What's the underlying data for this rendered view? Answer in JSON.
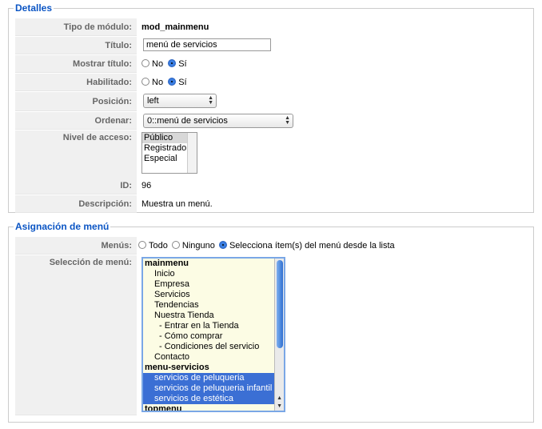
{
  "details": {
    "legend": "Detalles",
    "module_type_label": "Tipo de módulo:",
    "module_type_value": "mod_mainmenu",
    "title_label": "Título:",
    "title_value": "menú de servicios",
    "show_title_label": "Mostrar título:",
    "show_title_no": "No",
    "show_title_yes": "Sí",
    "enabled_label": "Habilitado:",
    "enabled_no": "No",
    "enabled_yes": "Sí",
    "position_label": "Posición:",
    "position_value": "left",
    "order_label": "Ordenar:",
    "order_value": "0::menú de servicios",
    "access_label": "Nivel de acceso:",
    "access_options": [
      "Público",
      "Registrado",
      "Especial"
    ],
    "id_label": "ID:",
    "id_value": "96",
    "description_label": "Descripción:",
    "description_value": "Muestra un menú."
  },
  "assignment": {
    "legend": "Asignación de menú",
    "menus_label": "Menús:",
    "opt_all": "Todo",
    "opt_none": "Ninguno",
    "opt_select": "Selecciona ítem(s) del menú desde la lista",
    "selection_label": "Selección de menú:",
    "items": [
      "mainmenu",
      "Inicio",
      "Empresa",
      "Servicios",
      "Tendencias",
      "Nuestra Tienda",
      "- Entrar en la Tienda",
      "- Cómo comprar",
      "- Condiciones del servicio",
      "Contacto",
      "menu-servicios",
      "servicios de peluqueria",
      "servicios de peluqueria infantil",
      "servicios de estética",
      "topmenu"
    ]
  }
}
